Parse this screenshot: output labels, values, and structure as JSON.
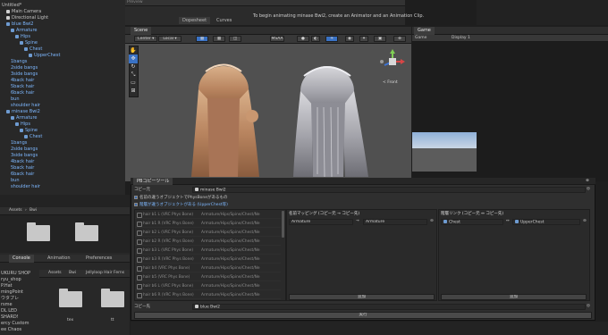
{
  "hierarchy": {
    "items": [
      {
        "label": "Untitled*",
        "indent": 0,
        "color": "white",
        "icon": false
      },
      {
        "label": "Main Camera",
        "indent": 1,
        "color": "white",
        "icon": true
      },
      {
        "label": "Directional Light",
        "indent": 1,
        "color": "white",
        "icon": true
      },
      {
        "label": "blue Bwi2",
        "indent": 1,
        "color": "blue",
        "icon": true
      },
      {
        "label": "Armature",
        "indent": 2,
        "color": "blue",
        "icon": true
      },
      {
        "label": "Hips",
        "indent": 3,
        "color": "blue",
        "icon": true
      },
      {
        "label": "Spine",
        "indent": 4,
        "color": "blue",
        "icon": true
      },
      {
        "label": "Chest",
        "indent": 5,
        "color": "blue",
        "icon": true
      },
      {
        "label": "UpperChest",
        "indent": 6,
        "color": "blue",
        "icon": true
      },
      {
        "label": "1bangs",
        "indent": 2,
        "color": "blue",
        "icon": false
      },
      {
        "label": "2side bangs",
        "indent": 2,
        "color": "blue",
        "icon": false
      },
      {
        "label": "3side bangs",
        "indent": 2,
        "color": "blue",
        "icon": false
      },
      {
        "label": "4back hair",
        "indent": 2,
        "color": "blue",
        "icon": false
      },
      {
        "label": "5back hair",
        "indent": 2,
        "color": "blue",
        "icon": false
      },
      {
        "label": "6back hair",
        "indent": 2,
        "color": "blue",
        "icon": false
      },
      {
        "label": "bun",
        "indent": 2,
        "color": "blue",
        "icon": false
      },
      {
        "label": "shoulder hair",
        "indent": 2,
        "color": "blue",
        "icon": false
      },
      {
        "label": "minase Bwi2",
        "indent": 1,
        "color": "blue",
        "icon": true
      },
      {
        "label": "Armature",
        "indent": 2,
        "color": "blue",
        "icon": true
      },
      {
        "label": "Hips",
        "indent": 3,
        "color": "blue",
        "icon": true
      },
      {
        "label": "Spine",
        "indent": 4,
        "color": "blue",
        "icon": true
      },
      {
        "label": "Chest",
        "indent": 5,
        "color": "blue",
        "icon": true
      },
      {
        "label": "1bangs",
        "indent": 2,
        "color": "blue",
        "icon": false
      },
      {
        "label": "2side bangs",
        "indent": 2,
        "color": "blue",
        "icon": false
      },
      {
        "label": "3side bangs",
        "indent": 2,
        "color": "blue",
        "icon": false
      },
      {
        "label": "4back hair",
        "indent": 2,
        "color": "blue",
        "icon": false
      },
      {
        "label": "5back hair",
        "indent": 2,
        "color": "blue",
        "icon": false
      },
      {
        "label": "6back hair",
        "indent": 2,
        "color": "blue",
        "icon": false
      },
      {
        "label": "bun",
        "indent": 2,
        "color": "blue",
        "icon": false
      },
      {
        "label": "shoulder hair",
        "indent": 2,
        "color": "blue",
        "icon": false
      }
    ]
  },
  "timeline": {
    "preview": "Preview",
    "dopesheet": "Dopesheet",
    "curves": "Curves",
    "message": "To begin animating minase Bwi2, create an Animator and an Animation Clip."
  },
  "scene": {
    "tab": "Scene",
    "pivot": "Center",
    "space": "Local",
    "msaa": "MSAA",
    "gizmo_label": "< Front"
  },
  "game": {
    "tab": "Game",
    "display_mode": "Game",
    "display": "Display 1"
  },
  "project": {
    "path": [
      "Assets",
      "Bwi"
    ],
    "tabs": [
      "Console",
      "Animation",
      "Preferences"
    ],
    "path2": [
      "Assets",
      "Bwi",
      "Jellyloop Hair Ferns"
    ],
    "folders": [
      "tex",
      "tt"
    ],
    "left_list": [
      "UKURU SHOP",
      "ryu_shop",
      "P.Hat",
      "mingPoint",
      "ウタプレ",
      "rsme",
      "DL LED",
      "SHARD!",
      "ercy Custom",
      "ee Chaos"
    ]
  },
  "tool": {
    "title": "PBコピーツール",
    "source_label": "コピー元",
    "source_value": "minase Bwi2",
    "option1": "名前の違うオブジェクトでPhysBoneがあるもの",
    "option2": "階層が違うオブジェクトがある (UpperChest等)",
    "dest_label": "コピー先",
    "dest_value": "blue Bwi2",
    "execute": "実行",
    "bones": [
      {
        "name": "hair b1 L (VRC Phys Bone)",
        "path": "Armature/Hips/Spine/Chest/Ne"
      },
      {
        "name": "hair b1 R (VRC Phys Bone)",
        "path": "Armature/Hips/Spine/Chest/Ne"
      },
      {
        "name": "hair b2 L (VRC Phys Bone)",
        "path": "Armature/Hips/Spine/Chest/Ne"
      },
      {
        "name": "hair b2 R (VRC Phys Bone)",
        "path": "Armature/Hips/Spine/Chest/Ne"
      },
      {
        "name": "hair b3 L (VRC Phys Bone)",
        "path": "Armature/Hips/Spine/Chest/Ne"
      },
      {
        "name": "hair b3 R (VRC Phys Bone)",
        "path": "Armature/Hips/Spine/Chest/Ne"
      },
      {
        "name": "hair b4 (VRC Phys Bone)",
        "path": "Armature/Hips/Spine/Chest/Ne"
      },
      {
        "name": "hair b5 (VRC Phys Bone)",
        "path": "Armature/Hips/Spine/Chest/Ne"
      },
      {
        "name": "hair b6 L (VRC Phys Bone)",
        "path": "Armature/Hips/Spine/Chest/Ne"
      },
      {
        "name": "hair b6 R (VRC Phys Bone)",
        "path": "Armature/Hips/Spine/Chest/Ne"
      }
    ],
    "name_map": {
      "title": "名前マッピング (コピー元 → コピー先)",
      "from": "Armature",
      "to": "Armature",
      "add": "追加"
    },
    "hier_link": {
      "title": "階層リンク (コピー元 ↔ コピー先)",
      "from": "Chest",
      "to": "UpperChest",
      "add": "追加"
    }
  },
  "colors": {
    "accent": "#3a72c4",
    "blue_text": "#7eb8ff",
    "sky_top": "#8fb0d8",
    "ground": "#5c5c5c"
  }
}
